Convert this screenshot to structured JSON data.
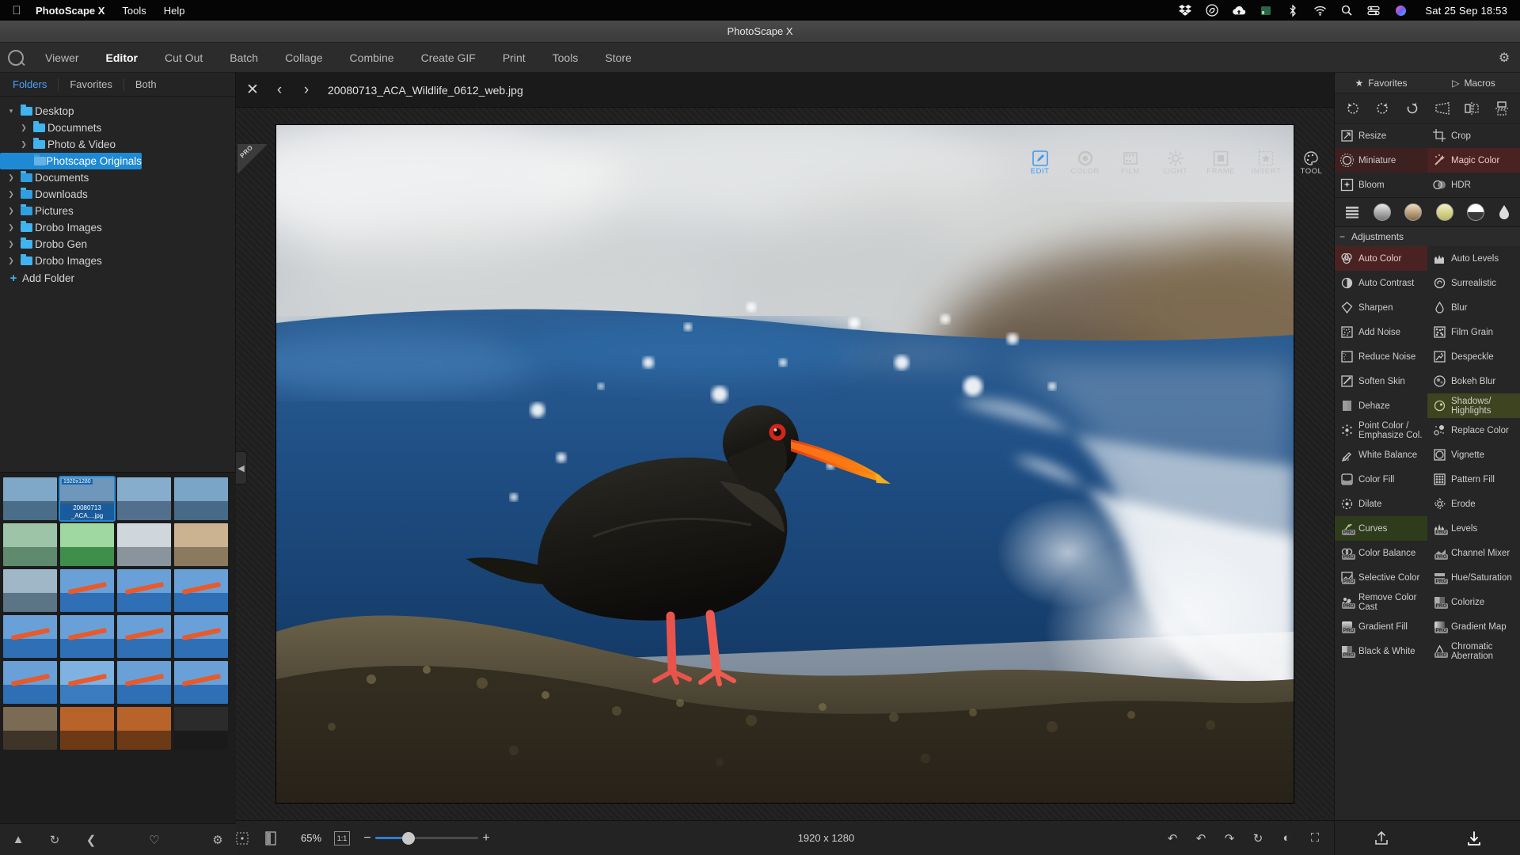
{
  "menubar": {
    "apple_icon": "apple-logo-icon",
    "items": [
      {
        "label": "PhotoScape X",
        "bold": true
      },
      {
        "label": "Tools",
        "bold": false
      },
      {
        "label": "Help",
        "bold": false
      }
    ],
    "status_icons": [
      "dropbox-icon",
      "creative-cloud-icon",
      "cloud-upload-icon",
      "battery-icon",
      "bluetooth-icon",
      "wifi-icon",
      "search-icon",
      "control-center-icon",
      "siri-icon"
    ],
    "clock": "Sat 25 Sep  18:53"
  },
  "window": {
    "title": "PhotoScape X"
  },
  "tabbar": {
    "logo_icon": "photoscape-logo-icon",
    "tabs": [
      {
        "label": "Viewer",
        "active": false
      },
      {
        "label": "Editor",
        "active": true
      },
      {
        "label": "Cut Out",
        "active": false
      },
      {
        "label": "Batch",
        "active": false
      },
      {
        "label": "Collage",
        "active": false
      },
      {
        "label": "Combine",
        "active": false
      },
      {
        "label": "Create GIF",
        "active": false
      },
      {
        "label": "Print",
        "active": false
      },
      {
        "label": "Tools",
        "active": false
      },
      {
        "label": "Store",
        "active": false
      }
    ],
    "settings_icon": "gear-icon"
  },
  "sidebar": {
    "tabs": [
      {
        "label": "Folders",
        "active": true
      },
      {
        "label": "Favorites",
        "active": false
      },
      {
        "label": "Both",
        "active": false
      }
    ],
    "tree": [
      {
        "label": "Desktop",
        "depth": 0,
        "arrow": "down",
        "selected": false
      },
      {
        "label": "Documnets",
        "depth": 1,
        "arrow": "right",
        "selected": false
      },
      {
        "label": "Photo & Video",
        "depth": 1,
        "arrow": "right",
        "selected": false
      },
      {
        "label": "Photscape Originals",
        "depth": 2,
        "arrow": "none",
        "selected": true
      },
      {
        "label": "Documents",
        "depth": 0,
        "arrow": "right",
        "selected": false
      },
      {
        "label": "Downloads",
        "depth": 0,
        "arrow": "right",
        "selected": false
      },
      {
        "label": "Pictures",
        "depth": 0,
        "arrow": "right",
        "selected": false
      },
      {
        "label": "Drobo Images",
        "depth": 0,
        "arrow": "right",
        "selected": false
      },
      {
        "label": "Drobo Gen",
        "depth": 0,
        "arrow": "right",
        "selected": false
      },
      {
        "label": "Drobo Images",
        "depth": 0,
        "arrow": "right",
        "selected": false
      }
    ],
    "add_folder_label": "Add Folder",
    "bottom_icons": [
      "home-icon",
      "refresh-icon",
      "back-icon",
      "heart-icon",
      "gear-icon"
    ]
  },
  "thumbnails": {
    "selected_index": 1,
    "selected_dimension_badge": "1920x1280",
    "selected_label_line1": "20080713",
    "selected_label_line2": "_ACA....jpg",
    "count": 24
  },
  "filebar": {
    "close_icon": "close-icon",
    "prev_icon": "chevron-left-icon",
    "next_icon": "chevron-right-icon",
    "filename": "20080713_ACA_Wildlife_0612_web.jpg",
    "pro_badge": "PRO"
  },
  "edit_tabs": [
    {
      "label": "EDIT",
      "icon": "edit-pencil-icon",
      "active": true
    },
    {
      "label": "COLOR",
      "icon": "color-circle-icon",
      "active": false
    },
    {
      "label": "FILM",
      "icon": "film-strip-icon",
      "active": false
    },
    {
      "label": "LIGHT",
      "icon": "sun-icon",
      "active": false
    },
    {
      "label": "FRAME",
      "icon": "frame-square-icon",
      "active": false
    },
    {
      "label": "INSERT",
      "icon": "insert-star-icon",
      "active": false
    },
    {
      "label": "TOOL",
      "icon": "palette-icon",
      "active": false
    }
  ],
  "rightpanel": {
    "favorites_label": "Favorites",
    "favorites_icon": "star-icon",
    "macros_label": "Macros",
    "macros_icon": "play-triangle-icon",
    "rotate_icons": [
      "rotate-left-icon",
      "rotate-right-icon",
      "rotate-free-icon",
      "perspective-icon",
      "flip-horizontal-icon",
      "flip-vertical-icon"
    ],
    "quick_tools": [
      {
        "label": "Resize",
        "icon": "resize-icon",
        "highlight": "none"
      },
      {
        "label": "Crop",
        "icon": "crop-icon",
        "highlight": "none"
      },
      {
        "label": "Miniature",
        "icon": "miniature-icon",
        "highlight": "redbox"
      },
      {
        "label": "Magic Color",
        "icon": "magic-wand-icon",
        "highlight": "red"
      },
      {
        "label": "Bloom",
        "icon": "bloom-icon",
        "highlight": "none"
      },
      {
        "label": "HDR",
        "icon": "hdr-icon",
        "highlight": "none"
      }
    ],
    "filter_swatches": [
      "list-icon",
      "gray-circle",
      "sepia-circle",
      "yellow-circle",
      "split-circle",
      "drop-icon"
    ],
    "adjustments_header": "Adjustments",
    "adjustments_collapse_icon": "minus-icon",
    "adjustments": [
      {
        "label": "Auto Color",
        "icon": "auto-color-icon",
        "pro": false,
        "highlight": "red"
      },
      {
        "label": "Auto Levels",
        "icon": "auto-levels-icon",
        "pro": false,
        "highlight": "none"
      },
      {
        "label": "Auto Contrast",
        "icon": "auto-contrast-icon",
        "pro": false,
        "highlight": "none"
      },
      {
        "label": "Surrealistic",
        "icon": "surrealistic-icon",
        "pro": false,
        "highlight": "none"
      },
      {
        "label": "Sharpen",
        "icon": "sharpen-icon",
        "pro": false,
        "highlight": "none"
      },
      {
        "label": "Blur",
        "icon": "blur-drop-icon",
        "pro": false,
        "highlight": "none"
      },
      {
        "label": "Add Noise",
        "icon": "add-noise-icon",
        "pro": false,
        "highlight": "none"
      },
      {
        "label": "Film Grain",
        "icon": "film-grain-icon",
        "pro": false,
        "highlight": "none"
      },
      {
        "label": "Reduce Noise",
        "icon": "reduce-noise-icon",
        "pro": false,
        "highlight": "none"
      },
      {
        "label": "Despeckle",
        "icon": "despeckle-icon",
        "pro": false,
        "highlight": "none"
      },
      {
        "label": "Soften Skin",
        "icon": "soften-skin-icon",
        "pro": false,
        "highlight": "none"
      },
      {
        "label": "Bokeh Blur",
        "icon": "bokeh-blur-icon",
        "pro": false,
        "highlight": "none"
      },
      {
        "label": "Dehaze",
        "icon": "dehaze-icon",
        "pro": false,
        "highlight": "none"
      },
      {
        "label": "Shadows/\nHighlights",
        "icon": "shadows-highlights-icon",
        "pro": false,
        "highlight": "olive"
      },
      {
        "label": "Point Color /\nEmphasize Col.",
        "icon": "point-color-icon",
        "pro": false,
        "highlight": "none"
      },
      {
        "label": "Replace Color",
        "icon": "replace-color-icon",
        "pro": false,
        "highlight": "none"
      },
      {
        "label": "White Balance",
        "icon": "white-balance-icon",
        "pro": false,
        "highlight": "none"
      },
      {
        "label": "Vignette",
        "icon": "vignette-icon",
        "pro": false,
        "highlight": "none"
      },
      {
        "label": "Color Fill",
        "icon": "color-fill-icon",
        "pro": false,
        "highlight": "none"
      },
      {
        "label": "Pattern Fill",
        "icon": "pattern-fill-icon",
        "pro": false,
        "highlight": "none"
      },
      {
        "label": "Dilate",
        "icon": "dilate-icon",
        "pro": false,
        "highlight": "none"
      },
      {
        "label": "Erode",
        "icon": "erode-icon",
        "pro": false,
        "highlight": "none"
      },
      {
        "label": "Curves",
        "icon": "curves-icon",
        "pro": true,
        "highlight": "green"
      },
      {
        "label": "Levels",
        "icon": "levels-icon",
        "pro": true,
        "highlight": "none"
      },
      {
        "label": "Color Balance",
        "icon": "color-balance-icon",
        "pro": true,
        "highlight": "none"
      },
      {
        "label": "Channel Mixer",
        "icon": "channel-mixer-icon",
        "pro": true,
        "highlight": "none"
      },
      {
        "label": "Selective Color",
        "icon": "selective-color-icon",
        "pro": true,
        "highlight": "none"
      },
      {
        "label": "Hue/Saturation",
        "icon": "hue-saturation-icon",
        "pro": true,
        "highlight": "none"
      },
      {
        "label": "Remove Color\nCast",
        "icon": "remove-color-cast-icon",
        "pro": true,
        "highlight": "none"
      },
      {
        "label": "Colorize",
        "icon": "colorize-icon",
        "pro": true,
        "highlight": "none"
      },
      {
        "label": "Gradient Fill",
        "icon": "gradient-fill-icon",
        "pro": true,
        "highlight": "none"
      },
      {
        "label": "Gradient Map",
        "icon": "gradient-map-icon",
        "pro": true,
        "highlight": "none"
      },
      {
        "label": "Black & White",
        "icon": "black-white-icon",
        "pro": true,
        "highlight": "none"
      },
      {
        "label": "Chromatic\nAberration",
        "icon": "chromatic-aberration-icon",
        "pro": true,
        "highlight": "none"
      }
    ],
    "bottom_icons": [
      "share-icon",
      "save-download-icon"
    ]
  },
  "statusbar": {
    "fit_icon": "fit-screen-icon",
    "compare_icon": "compare-icon",
    "zoom_percent": "65%",
    "actual_size_label": "1:1",
    "minus": "−",
    "plus": "+",
    "zoom_value": 65,
    "image_dimensions": "1920 x 1280",
    "right_icons": [
      "undo-all-icon",
      "undo-icon",
      "redo-icon",
      "history-icon",
      "before-after-icon",
      "fullscreen-icon"
    ]
  },
  "colors": {
    "accent_blue": "#1e8ad6",
    "panel_bg": "#262626",
    "tree_selected": "#1e8ad6",
    "highlight_red": "#4a2222",
    "highlight_green": "#2e3c1c",
    "highlight_olive": "#3f4420"
  }
}
